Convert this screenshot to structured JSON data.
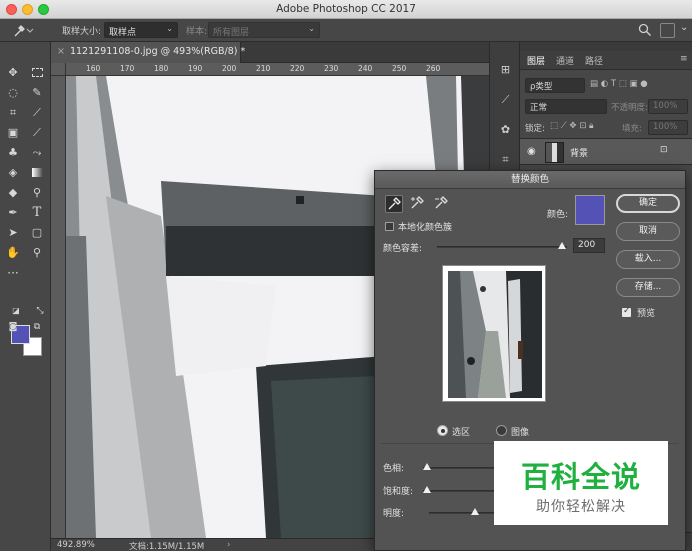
{
  "app": {
    "title": "Adobe Photoshop CC 2017"
  },
  "options_bar": {
    "sample_size_label": "取样大小:",
    "sample_size_value": "取样点",
    "sample_label": "样本:",
    "sample_value": "所有图层"
  },
  "document": {
    "tab_title": "1121291108-0.jpg @ 493%(RGB/8) *",
    "ruler_ticks": [
      "160",
      "170",
      "180",
      "190",
      "200",
      "210",
      "220",
      "230",
      "240",
      "250",
      "260"
    ],
    "status_zoom": "492.89%",
    "status_doc": "文档:1.15M/1.15M"
  },
  "layers_panel": {
    "tabs": [
      "图层",
      "通道",
      "路径"
    ],
    "filter_label": "ρ类型",
    "blend_mode": "正常",
    "opacity_label": "不透明度:",
    "opacity_value": "100%",
    "lock_label": "锁定:",
    "fill_label": "填充:",
    "fill_value": "100%",
    "layer_name": "背景"
  },
  "dialog": {
    "title": "替换颜色",
    "localized_label": "本地化颜色簇",
    "color_label": "颜色:",
    "fuzziness_label": "颜色容差:",
    "fuzziness_value": "200",
    "fuzziness_fraction": 0.96,
    "selection_label": "选区",
    "image_label": "图像",
    "hue_label": "色相:",
    "saturation_label": "饱和度:",
    "lightness_label": "明度:",
    "ok": "确定",
    "cancel": "取消",
    "load": "载入...",
    "save": "存储...",
    "preview": "预览",
    "selected_color": "#5452b5"
  },
  "colors": {
    "foreground": "#5452b5",
    "background": "#ffffff",
    "watermark_green": "#20b040"
  },
  "watermark": {
    "main": "百科全说",
    "sub": "助你轻松解决"
  }
}
